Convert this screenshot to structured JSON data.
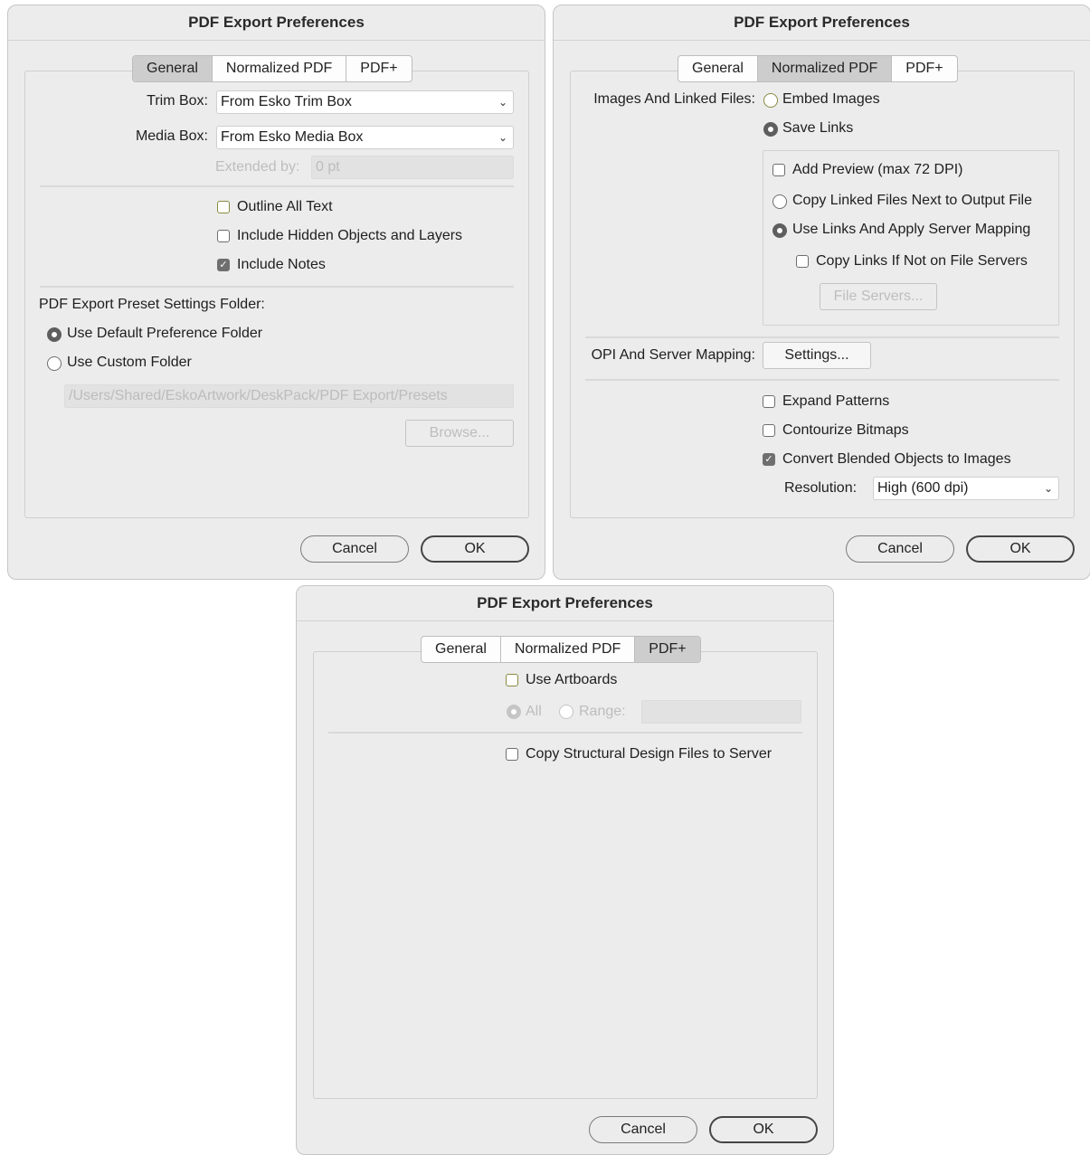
{
  "dialog_title": "PDF Export Preferences",
  "tabs": [
    "General",
    "Normalized PDF",
    "PDF+"
  ],
  "buttons": {
    "cancel": "Cancel",
    "ok": "OK"
  },
  "general": {
    "trim_box_label": "Trim Box:",
    "trim_box_value": "From Esko Trim Box",
    "media_box_label": "Media Box:",
    "media_box_value": "From Esko Media Box",
    "extended_by_label": "Extended by:",
    "extended_by_value": "0 pt",
    "outline_all_text": "Outline All Text",
    "include_hidden": "Include Hidden Objects and Layers",
    "include_notes": "Include Notes",
    "include_notes_checked": true,
    "preset_folder_label": "PDF Export Preset Settings Folder:",
    "use_default_folder": "Use Default Preference Folder",
    "use_custom_folder": "Use Custom Folder",
    "folder_selected": "Use Default Preference Folder",
    "custom_path": "/Users/Shared/EskoArtwork/DeskPack/PDF Export/Presets",
    "browse_button": "Browse..."
  },
  "normalized": {
    "images_linked_label": "Images And Linked Files:",
    "embed_images": "Embed Images",
    "save_links": "Save Links",
    "images_selected": "Save Links",
    "add_preview": "Add Preview (max 72 DPI)",
    "copy_linked_files": "Copy Linked Files Next to Output File",
    "use_links_mapping": "Use Links And Apply Server Mapping",
    "links_selected": "Use Links And Apply Server Mapping",
    "copy_links_not_on_servers": "Copy Links If Not on File Servers",
    "file_servers_button": "File Servers...",
    "opi_label": "OPI And Server Mapping:",
    "settings_button": "Settings...",
    "expand_patterns": "Expand Patterns",
    "contourize_bitmaps": "Contourize Bitmaps",
    "convert_blended": "Convert Blended Objects to Images",
    "convert_blended_checked": true,
    "resolution_label": "Resolution:",
    "resolution_value": "High (600 dpi)"
  },
  "pdfplus": {
    "use_artboards": "Use Artboards",
    "all_label": "All",
    "range_label": "Range:",
    "copy_structural": "Copy Structural Design Files to Server"
  }
}
